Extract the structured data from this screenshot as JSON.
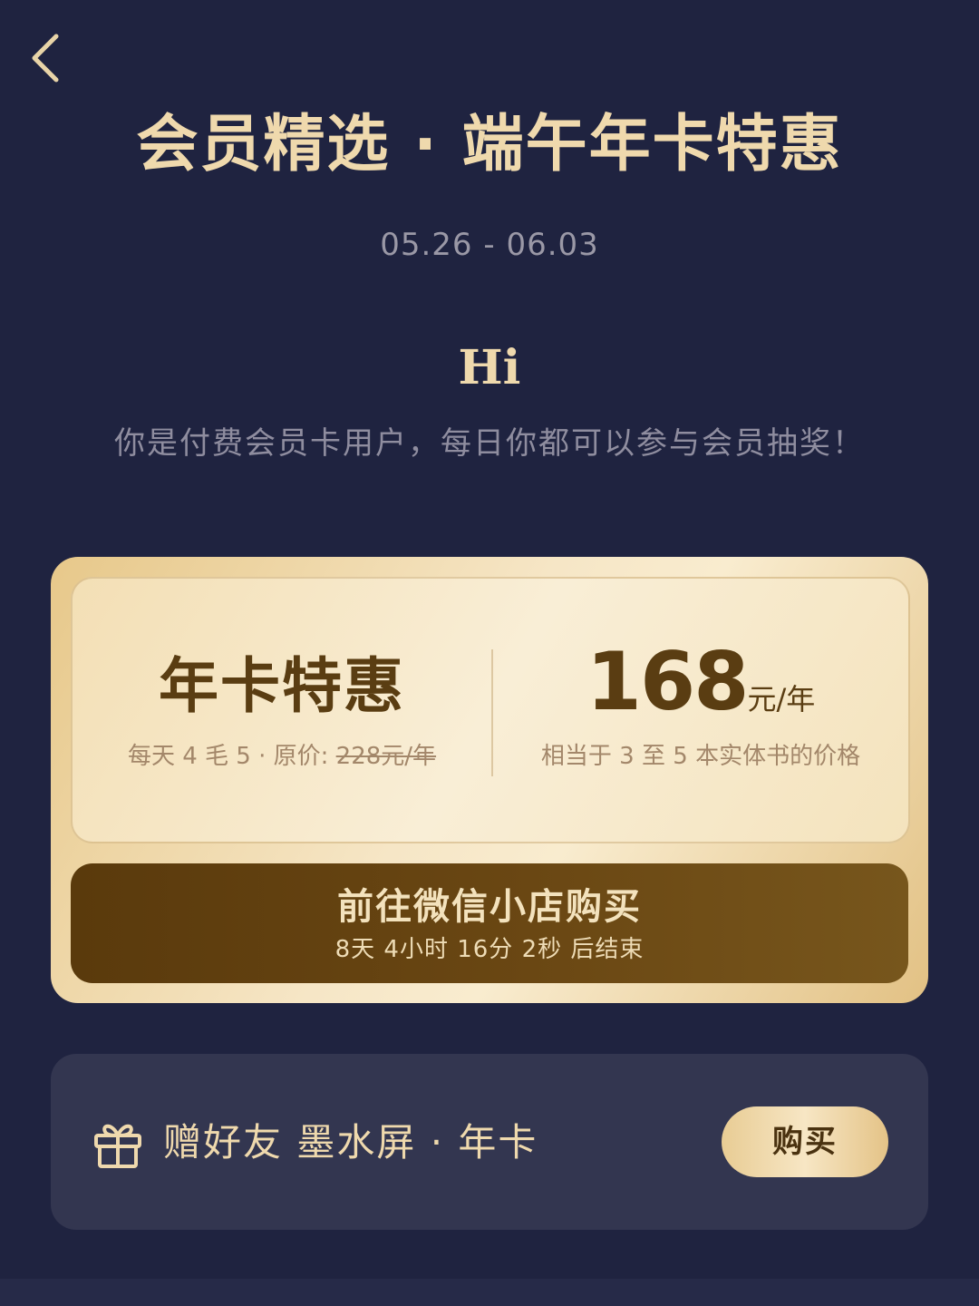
{
  "header": {
    "title": "会员精选 · 端午年卡特惠",
    "date_range": "05.26 - 06.03"
  },
  "greeting": {
    "hi": "Hi",
    "message": "你是付费会员卡用户，每日你都可以参与会员抽奖！"
  },
  "offer": {
    "name": "年卡特惠",
    "daily_cost": "每天 4 毛 5 · 原价: ",
    "original_price": "228元/年",
    "price": "168",
    "price_unit": "元/年",
    "price_desc": "相当于 3 至 5 本实体书的价格"
  },
  "purchase": {
    "label": "前往微信小店购买",
    "countdown": "8天 4小时 16分 2秒 后结束"
  },
  "gift": {
    "label": "赠好友 墨水屏 · 年卡",
    "button": "购买"
  },
  "colors": {
    "background": "#1f2340",
    "gold_text": "#efd9ad",
    "brown_button": "#6a4713",
    "card_gold": "#f6e6c6"
  },
  "icons": {
    "back": "chevron-left-icon",
    "gift": "gift-icon"
  }
}
